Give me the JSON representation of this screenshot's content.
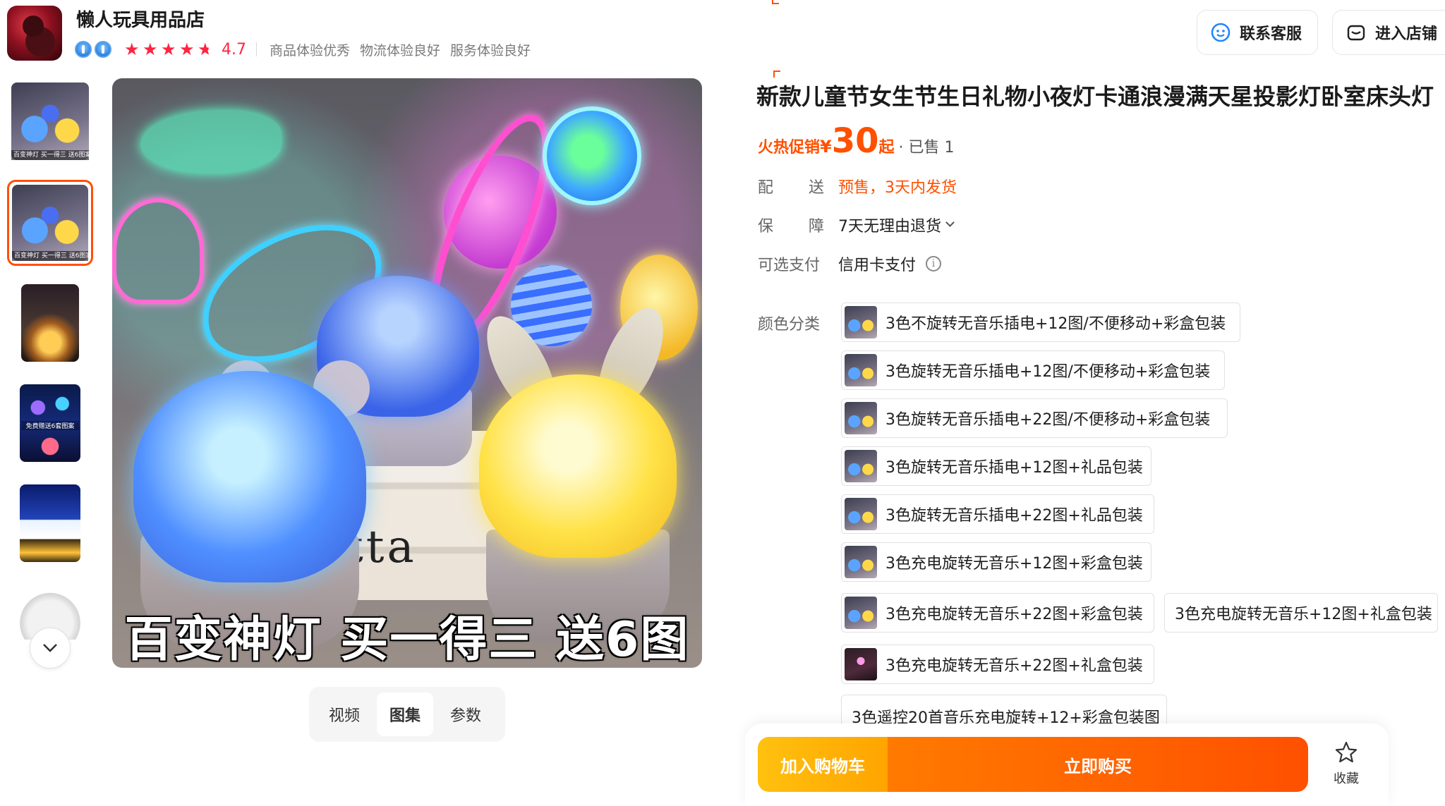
{
  "shop": {
    "name": "懒人玩具用品店",
    "rating": "4.7",
    "stars": "★★★★★",
    "meta": [
      "商品体验优秀",
      "物流体验良好",
      "服务体验良好"
    ]
  },
  "header_buttons": {
    "service": "联系客服",
    "enter_shop": "进入店铺"
  },
  "gallery": {
    "thumb_caption": "百变神灯 买一得三 送6图案",
    "thumb4_caption": "免费赠送6套图案",
    "main_caption": "百变神灯 买一得三 送6图案",
    "books_text": "tta"
  },
  "media_tabs": [
    "视频",
    "图集",
    "参数"
  ],
  "media_tabs_active": 1,
  "product": {
    "title": "新款儿童节女生节生日礼物小夜灯卡通浪漫满天星投影灯卧室床头灯",
    "price_tag": "火热促销",
    "currency": "¥",
    "price": "30",
    "price_suffix": "起",
    "sold": "· 已售 1"
  },
  "info": {
    "delivery": {
      "label_a": "配",
      "label_b": "送",
      "value": "预售，3天内发货"
    },
    "guarantee": {
      "label_a": "保",
      "label_b": "障",
      "value": "7天无理由退货"
    },
    "payment": {
      "label": "可选支付",
      "value": "信用卡支付"
    }
  },
  "sku": {
    "label": "颜色分类",
    "options": [
      "3色不旋转无音乐插电+12图/不便移动+彩盒包装",
      "3色旋转无音乐插电+12图/不便移动+彩盒包装",
      "3色旋转无音乐插电+22图/不便移动+彩盒包装",
      "3色旋转无音乐插电+12图+礼品包装",
      "3色旋转无音乐插电+22图+礼品包装",
      "3色充电旋转无音乐+12图+彩盒包装",
      "3色充电旋转无音乐+22图+彩盒包装",
      "3色充电旋转无音乐+12图+礼盒包装",
      "3色充电旋转无音乐+22图+礼盒包装",
      "3色遥控20首音乐充电旋转+12+彩盒包装图"
    ]
  },
  "actions": {
    "add_to_cart": "加入购物车",
    "buy_now": "立即购买",
    "favorite": "收藏"
  },
  "colors": {
    "accent": "#ff5000",
    "rating": "#ff2442",
    "cart_gradient_start": "#ffc10f",
    "buy_gradient_end": "#ff5000"
  }
}
